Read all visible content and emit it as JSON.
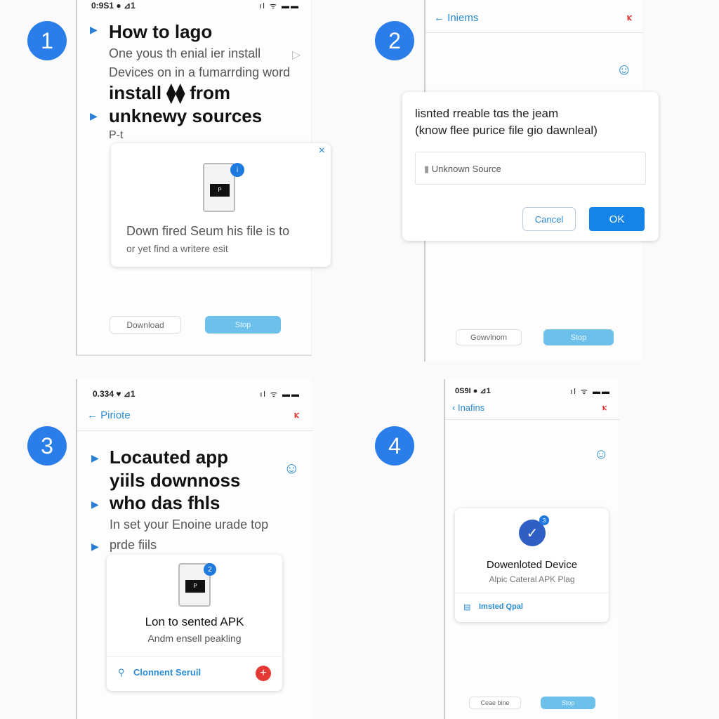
{
  "colors": {
    "accent": "#2b7de9",
    "link": "#2a8ad0",
    "danger": "#e53935",
    "stop_button": "#6cc0ea"
  },
  "steps": [
    "1",
    "2",
    "3",
    "4"
  ],
  "panel1": {
    "status_time": "0:9S1 ● ⊿1",
    "title_lines": [
      "How to lago",
      "install ⧫⧫ from",
      "unknewy sources"
    ],
    "body_lines": [
      "One yous th enial ier install",
      "Devices on in a fumarrding word"
    ],
    "fragment": "P-t",
    "card": {
      "text": "Down fired Seum his file is to",
      "subtext": "or yet find a writere esit",
      "doc_label": "P",
      "badge": "i",
      "close": "×"
    },
    "download_label": "Download",
    "stop_label": "Stop"
  },
  "panel2": {
    "back_label": "Iniems",
    "dialog": {
      "line1": "lisnted rreable tɑs the jeam",
      "line2": "(know flee purice file gio dawnleal)",
      "field_value": "Unknown Source",
      "cancel_label": "Cancel",
      "ok_label": "OK"
    },
    "download_label": "Gowvlnom",
    "stop_label": "Stop"
  },
  "panel3": {
    "status_time": "0.334 ♥ ⊿1",
    "back_label": "Piriote",
    "title_lines": [
      "Locauted app",
      "yiils downnoss",
      "who das fhls"
    ],
    "body_line": "In set your Enoine urade top",
    "bullet_line": "prde fiils",
    "card": {
      "title": "Lon to sented APK",
      "subtitle": "Andm ensell peakling",
      "link": "Clonnent Seruil",
      "badge": "2",
      "doc_label": "P"
    }
  },
  "panel4": {
    "status_time": "0S9I ● ⊿1",
    "back_label": "Inafins",
    "card": {
      "title": "Dowenloted Device",
      "subtitle": "Alpic Cateral APK Plag",
      "link": "Imsted Qpal",
      "badge": "3"
    },
    "left_label": "Ceae bine",
    "stop_label": "Stop"
  }
}
